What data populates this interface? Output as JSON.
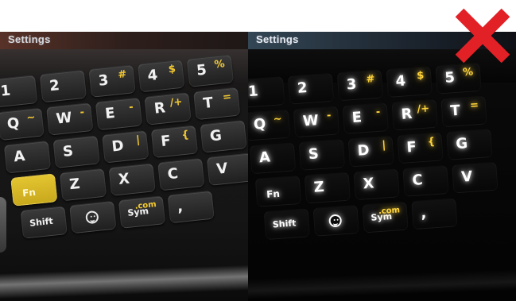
{
  "photos": [
    {
      "screen_title": "Settings",
      "keys": [
        {
          "main": "1",
          "alt": ""
        },
        {
          "main": "2",
          "alt": ""
        },
        {
          "main": "3",
          "alt": "#"
        },
        {
          "main": "4",
          "alt": "$"
        },
        {
          "main": "5",
          "alt": "%"
        },
        {
          "main": "Q",
          "alt": "~"
        },
        {
          "main": "W",
          "alt": "-"
        },
        {
          "main": "E",
          "alt": "-"
        },
        {
          "main": "R",
          "alt": "/+"
        },
        {
          "main": "T",
          "alt": "="
        },
        {
          "main": "A",
          "alt": ""
        },
        {
          "main": "S",
          "alt": ""
        },
        {
          "main": "D",
          "alt": "|"
        },
        {
          "main": "F",
          "alt": "{"
        },
        {
          "main": "G",
          "alt": ""
        },
        {
          "main": "Fn",
          "alt": ""
        },
        {
          "main": "Z",
          "alt": ""
        },
        {
          "main": "X",
          "alt": ""
        },
        {
          "main": "C",
          "alt": ""
        },
        {
          "main": "V",
          "alt": ""
        },
        {
          "main": "Shift",
          "alt": ""
        },
        {
          "main": "",
          "alt": ""
        },
        {
          "main": "Sym",
          "alt": ".com"
        },
        {
          "main": ",",
          "alt": ""
        }
      ]
    },
    {
      "screen_title": "Settings",
      "keys": [
        {
          "main": "1",
          "alt": ""
        },
        {
          "main": "2",
          "alt": ""
        },
        {
          "main": "3",
          "alt": "#"
        },
        {
          "main": "4",
          "alt": "$"
        },
        {
          "main": "5",
          "alt": "%"
        },
        {
          "main": "Q",
          "alt": "~"
        },
        {
          "main": "W",
          "alt": "-"
        },
        {
          "main": "E",
          "alt": "-"
        },
        {
          "main": "R",
          "alt": "/+"
        },
        {
          "main": "T",
          "alt": "="
        },
        {
          "main": "A",
          "alt": ""
        },
        {
          "main": "S",
          "alt": ""
        },
        {
          "main": "D",
          "alt": "|"
        },
        {
          "main": "F",
          "alt": "{"
        },
        {
          "main": "G",
          "alt": ""
        },
        {
          "main": "Fn",
          "alt": ""
        },
        {
          "main": "Z",
          "alt": ""
        },
        {
          "main": "X",
          "alt": ""
        },
        {
          "main": "C",
          "alt": ""
        },
        {
          "main": "V",
          "alt": ""
        },
        {
          "main": "Shift",
          "alt": ""
        },
        {
          "main": "",
          "alt": ""
        },
        {
          "main": "Sym",
          "alt": ".com"
        },
        {
          "main": ",",
          "alt": ""
        }
      ]
    }
  ],
  "overlay": {
    "x_mark_icon": "x-mark",
    "x_mark_color": "#e22127"
  }
}
